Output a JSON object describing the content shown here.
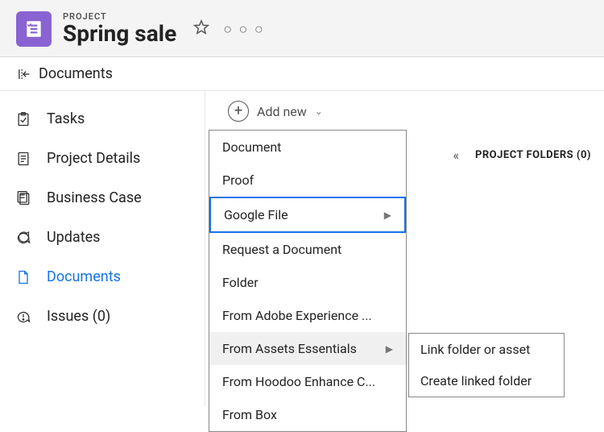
{
  "header": {
    "project_label": "PROJECT",
    "project_title": "Spring sale"
  },
  "subheader": {
    "title": "Documents"
  },
  "sidebar": {
    "items": [
      {
        "label": "Tasks"
      },
      {
        "label": "Project Details"
      },
      {
        "label": "Business Case"
      },
      {
        "label": "Updates"
      },
      {
        "label": "Documents"
      },
      {
        "label": "Issues (0)"
      }
    ]
  },
  "toolbar": {
    "add_new_label": "Add new"
  },
  "dropdown": {
    "items": [
      {
        "label": "Document"
      },
      {
        "label": "Proof"
      },
      {
        "label": "Google File",
        "has_sub": true,
        "selected": true
      },
      {
        "label": "Request a Document"
      },
      {
        "label": "Folder"
      },
      {
        "label": "From Adobe Experience ..."
      },
      {
        "label": "From Assets Essentials",
        "has_sub": true,
        "hovered": true
      },
      {
        "label": "From Hoodoo Enhance C..."
      },
      {
        "label": "From Box"
      }
    ]
  },
  "submenu": {
    "items": [
      {
        "label": "Link folder or asset"
      },
      {
        "label": "Create linked folder"
      }
    ]
  },
  "right_panel": {
    "folders_label": "PROJECT FOLDERS (0)"
  }
}
